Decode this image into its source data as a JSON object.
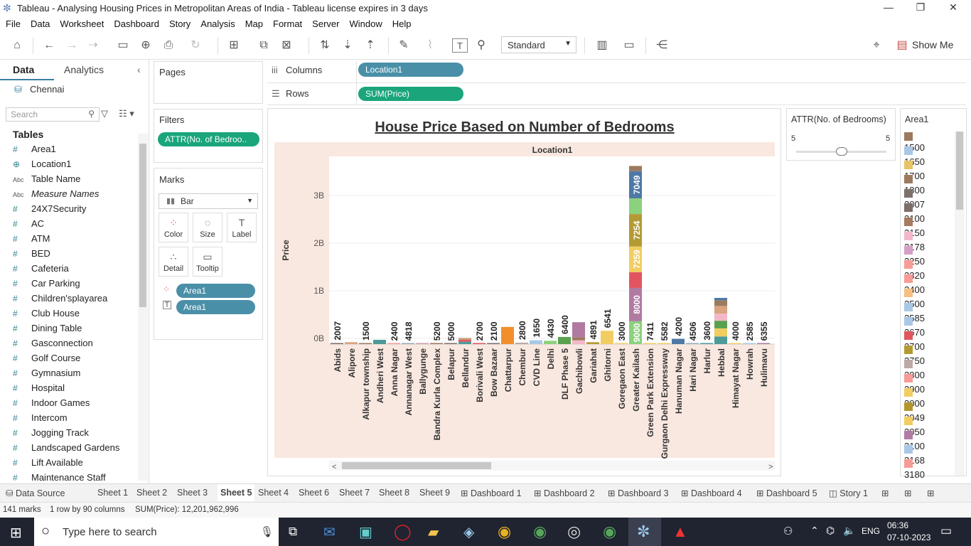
{
  "window": {
    "title": "Tableau - Analysing Housing Prices in Metropolitan Areas of India - Tableau license expires in 3 days"
  },
  "menu": [
    "File",
    "Data",
    "Worksheet",
    "Dashboard",
    "Story",
    "Analysis",
    "Map",
    "Format",
    "Server",
    "Window",
    "Help"
  ],
  "toolbar": {
    "fit_value": "Standard",
    "show_me": "Show Me"
  },
  "left_panel": {
    "tab_data": "Data",
    "tab_analytics": "Analytics",
    "datasource": "Chennai",
    "search_placeholder": "Search",
    "tables_heading": "Tables",
    "fields": [
      {
        "icon": "#",
        "name": "Area1"
      },
      {
        "icon": "⊕",
        "name": "Location1"
      },
      {
        "icon": "Abc",
        "name": "Table Name"
      },
      {
        "icon": "Abc",
        "name": "Measure Names"
      },
      {
        "icon": "#",
        "name": "24X7Security"
      },
      {
        "icon": "#",
        "name": "AC"
      },
      {
        "icon": "#",
        "name": "ATM"
      },
      {
        "icon": "#",
        "name": "BED"
      },
      {
        "icon": "#",
        "name": "Cafeteria"
      },
      {
        "icon": "#",
        "name": "Car Parking"
      },
      {
        "icon": "#",
        "name": "Children'splayarea"
      },
      {
        "icon": "#",
        "name": "Club House"
      },
      {
        "icon": "#",
        "name": "Dining Table"
      },
      {
        "icon": "#",
        "name": "Gasconnection"
      },
      {
        "icon": "#",
        "name": "Golf Course"
      },
      {
        "icon": "#",
        "name": "Gymnasium"
      },
      {
        "icon": "#",
        "name": "Hospital"
      },
      {
        "icon": "#",
        "name": "Indoor Games"
      },
      {
        "icon": "#",
        "name": "Intercom"
      },
      {
        "icon": "#",
        "name": "Jogging Track"
      },
      {
        "icon": "#",
        "name": "Landscaped Gardens"
      },
      {
        "icon": "#",
        "name": "Lift Available"
      },
      {
        "icon": "#",
        "name": "Maintenance Staff"
      }
    ]
  },
  "cards": {
    "pages": "Pages",
    "filters": "Filters",
    "filter_pill": "ATTR(No. of Bedroo..",
    "marks": "Marks",
    "mark_type": "Bar",
    "mark_buttons": [
      "Color",
      "Size",
      "Label",
      "Detail",
      "Tooltip"
    ],
    "mark_pills": [
      "Area1",
      "Area1"
    ]
  },
  "shelves": {
    "columns_label": "Columns",
    "columns_pill": "Location1",
    "rows_label": "Rows",
    "rows_pill": "SUM(Price)"
  },
  "filter_card": {
    "title": "ATTR(No. of Bedrooms)",
    "min": "5",
    "max": "5",
    "position": 0.5
  },
  "legend": {
    "title": "Area1",
    "items": [
      {
        "label": "1500",
        "color": "#9c7a5f"
      },
      {
        "label": "1650",
        "color": "#a9c8e6"
      },
      {
        "label": "1700",
        "color": "#e9c466"
      },
      {
        "label": "1800",
        "color": "#9c7a5f"
      },
      {
        "label": "2007",
        "color": "#7e6f6a"
      },
      {
        "label": "2100",
        "color": "#7e6f6a"
      },
      {
        "label": "2150",
        "color": "#a67b5f"
      },
      {
        "label": "2178",
        "color": "#f4b7c9"
      },
      {
        "label": "2250",
        "color": "#d59fc6"
      },
      {
        "label": "2320",
        "color": "#f79c96"
      },
      {
        "label": "2400",
        "color": "#f79c96"
      },
      {
        "label": "2500",
        "color": "#f9bf7f"
      },
      {
        "label": "2585",
        "color": "#a9c8e6"
      },
      {
        "label": "2670",
        "color": "#a9c8e6"
      },
      {
        "label": "2700",
        "color": "#e2555e"
      },
      {
        "label": "2750",
        "color": "#b49a35"
      },
      {
        "label": "2800",
        "color": "#bcaaa6"
      },
      {
        "label": "2900",
        "color": "#f79c96"
      },
      {
        "label": "3000",
        "color": "#f1cd62"
      },
      {
        "label": "3049",
        "color": "#b39630"
      },
      {
        "label": "3050",
        "color": "#f1cd62"
      },
      {
        "label": "3100",
        "color": "#b27ba6"
      },
      {
        "label": "3168",
        "color": "#a9c8e6"
      },
      {
        "label": "3180",
        "color": "#f79c96"
      }
    ]
  },
  "chart_data": {
    "type": "bar",
    "title": "House Price Based on Number of Bedrooms",
    "header": "Location1",
    "ylabel": "Price",
    "y_ticks": [
      "0B",
      "1B",
      "2B",
      "3B"
    ],
    "ylim": [
      0,
      3750000000
    ],
    "categories": [
      "Abids",
      "Alipore",
      "Alkapur township",
      "Andheri West",
      "Anna Nagar",
      "Annanagar West",
      "Ballygunge",
      "Bandra Kurla Complex",
      "Belapur",
      "Bellandur",
      "Borivali West",
      "Bow Bazaar",
      "Chattarpur",
      "Chembur",
      "CVD Line",
      "Delhi",
      "DLF Phase 5",
      "Gachibowli",
      "Gariahat",
      "Ghitorni",
      "Goregaon East",
      "Greater Kailash",
      "Green Park Extension",
      "Gurgaon Delhi Expressway",
      "Hanuman Nagar",
      "Hari Nagar",
      "Harlur",
      "Hebbal",
      "Himayat Nagar",
      "Howrah",
      "Hulimavu"
    ],
    "bars": [
      {
        "label": "2007",
        "segments": [
          {
            "v": 20000000,
            "c": "#7e6f6a"
          }
        ]
      },
      {
        "label": "",
        "segments": [
          {
            "v": 40000000,
            "c": "#d9a47e"
          }
        ]
      },
      {
        "label": "1500",
        "segments": [
          {
            "v": 15000000,
            "c": "#9c7a5f"
          }
        ]
      },
      {
        "label": "",
        "segments": [
          {
            "v": 90000000,
            "c": "#4e9a9a"
          }
        ]
      },
      {
        "label": "2400",
        "segments": [
          {
            "v": 10000000,
            "c": "#f79c96"
          }
        ]
      },
      {
        "label": "4818",
        "segments": [
          {
            "v": 10000000,
            "c": "#9ab"
          }
        ]
      },
      {
        "label": "",
        "segments": [
          {
            "v": 10000000,
            "c": "#c9a0b0"
          }
        ]
      },
      {
        "label": "5200",
        "segments": [
          {
            "v": 12000000,
            "c": "#9c7a5f"
          }
        ]
      },
      {
        "label": "5000",
        "segments": [
          {
            "v": 8000000,
            "c": "#7e6f6a"
          }
        ]
      },
      {
        "label": "",
        "segments": [
          {
            "v": 50000000,
            "c": "#4e9a9a"
          },
          {
            "v": 40000000,
            "c": "#e2555e"
          },
          {
            "v": 40000000,
            "c": "#c7a17a"
          }
        ]
      },
      {
        "label": "2700",
        "segments": [
          {
            "v": 12000000,
            "c": "#e2555e"
          }
        ]
      },
      {
        "label": "2100",
        "segments": [
          {
            "v": 12000000,
            "c": "#7e6f6a"
          }
        ]
      },
      {
        "label": "",
        "segments": [
          {
            "v": 360000000,
            "c": "#f28e2b"
          }
        ]
      },
      {
        "label": "2800",
        "segments": [
          {
            "v": 30000000,
            "c": "#bcaaa6"
          }
        ]
      },
      {
        "label": "1650",
        "segments": [
          {
            "v": 80000000,
            "c": "#a9c8e6"
          }
        ]
      },
      {
        "label": "4430",
        "segments": [
          {
            "v": 70000000,
            "c": "#8cd17d"
          }
        ]
      },
      {
        "label": "6400",
        "segments": [
          {
            "v": 150000000,
            "c": "#59a14f"
          }
        ]
      },
      {
        "label": "",
        "segments": [
          {
            "v": 80000000,
            "c": "#f4b7c9"
          },
          {
            "v": 60000000,
            "c": "#9c7a5f"
          },
          {
            "v": 320000000,
            "c": "#b07aa1"
          }
        ]
      },
      {
        "label": "4891",
        "segments": [
          {
            "v": 40000000,
            "c": "#b49a35"
          }
        ]
      },
      {
        "label": "6541",
        "segments": [
          {
            "v": 280000000,
            "c": "#f1cd62"
          }
        ]
      },
      {
        "label": "3000",
        "segments": [
          {
            "v": 10000000,
            "c": "#f1cd62"
          }
        ]
      },
      {
        "label": "",
        "segments": [
          {
            "v": 480000000,
            "c": "#8cd17d"
          },
          {
            "v": 700000000,
            "c": "#b07aa1"
          },
          {
            "v": 330000000,
            "c": "#e2555e"
          },
          {
            "v": 540000000,
            "c": "#f1cd62"
          },
          {
            "v": 680000000,
            "c": "#b49a35"
          },
          {
            "v": 330000000,
            "c": "#8cd17d"
          },
          {
            "v": 570000000,
            "c": "#4e79a7"
          },
          {
            "v": 110000000,
            "c": "#9c7a5f"
          }
        ],
        "seg_labels": [
          "9000",
          "8000",
          "",
          "7259",
          "7254",
          "",
          "7049",
          ""
        ]
      },
      {
        "label": "7411",
        "segments": [
          {
            "v": 10000000,
            "c": "#f1cd62"
          }
        ]
      },
      {
        "label": "5582",
        "segments": [
          {
            "v": 10000000,
            "c": "#f1cd62"
          }
        ]
      },
      {
        "label": "4200",
        "segments": [
          {
            "v": 110000000,
            "c": "#4e79a7"
          }
        ]
      },
      {
        "label": "4506",
        "segments": [
          {
            "v": 10000000,
            "c": "#9ab"
          }
        ]
      },
      {
        "label": "3600",
        "segments": [
          {
            "v": 20000000,
            "c": "#4e9a9a"
          }
        ]
      },
      {
        "label": "",
        "segments": [
          {
            "v": 160000000,
            "c": "#4e9a9a"
          },
          {
            "v": 170000000,
            "c": "#f1cd62"
          },
          {
            "v": 160000000,
            "c": "#59a14f"
          },
          {
            "v": 150000000,
            "c": "#f4b7c9"
          },
          {
            "v": 160000000,
            "c": "#d9a47e"
          },
          {
            "v": 120000000,
            "c": "#9c7a5f"
          },
          {
            "v": 50000000,
            "c": "#4e79a7"
          }
        ]
      },
      {
        "label": "4000",
        "segments": [
          {
            "v": 15000000,
            "c": "#f1cd62"
          }
        ]
      },
      {
        "label": "2585",
        "segments": [
          {
            "v": 10000000,
            "c": "#a9c8e6"
          }
        ]
      },
      {
        "label": "6355",
        "segments": [
          {
            "v": 10000000,
            "c": "#b07aa1"
          }
        ]
      }
    ]
  },
  "sheet_tabs": [
    "Data Source",
    "Sheet 1",
    "Sheet 2",
    "Sheet 3",
    "Sheet 5",
    "Sheet 4",
    "Sheet 6",
    "Sheet 7",
    "Sheet 8",
    "Sheet 9",
    "Dashboard 1",
    "Dashboard 2",
    "Dashboard 3",
    "Dashboard 4",
    "Dashboard 5",
    "Story 1"
  ],
  "status": {
    "marks": "141 marks",
    "rows": "1 row by 90 columns",
    "sum": "SUM(Price): 12,201,962,996"
  },
  "taskbar": {
    "search_placeholder": "Type here to search",
    "lang": "ENG",
    "time": "06:36",
    "date": "07-10-2023"
  }
}
